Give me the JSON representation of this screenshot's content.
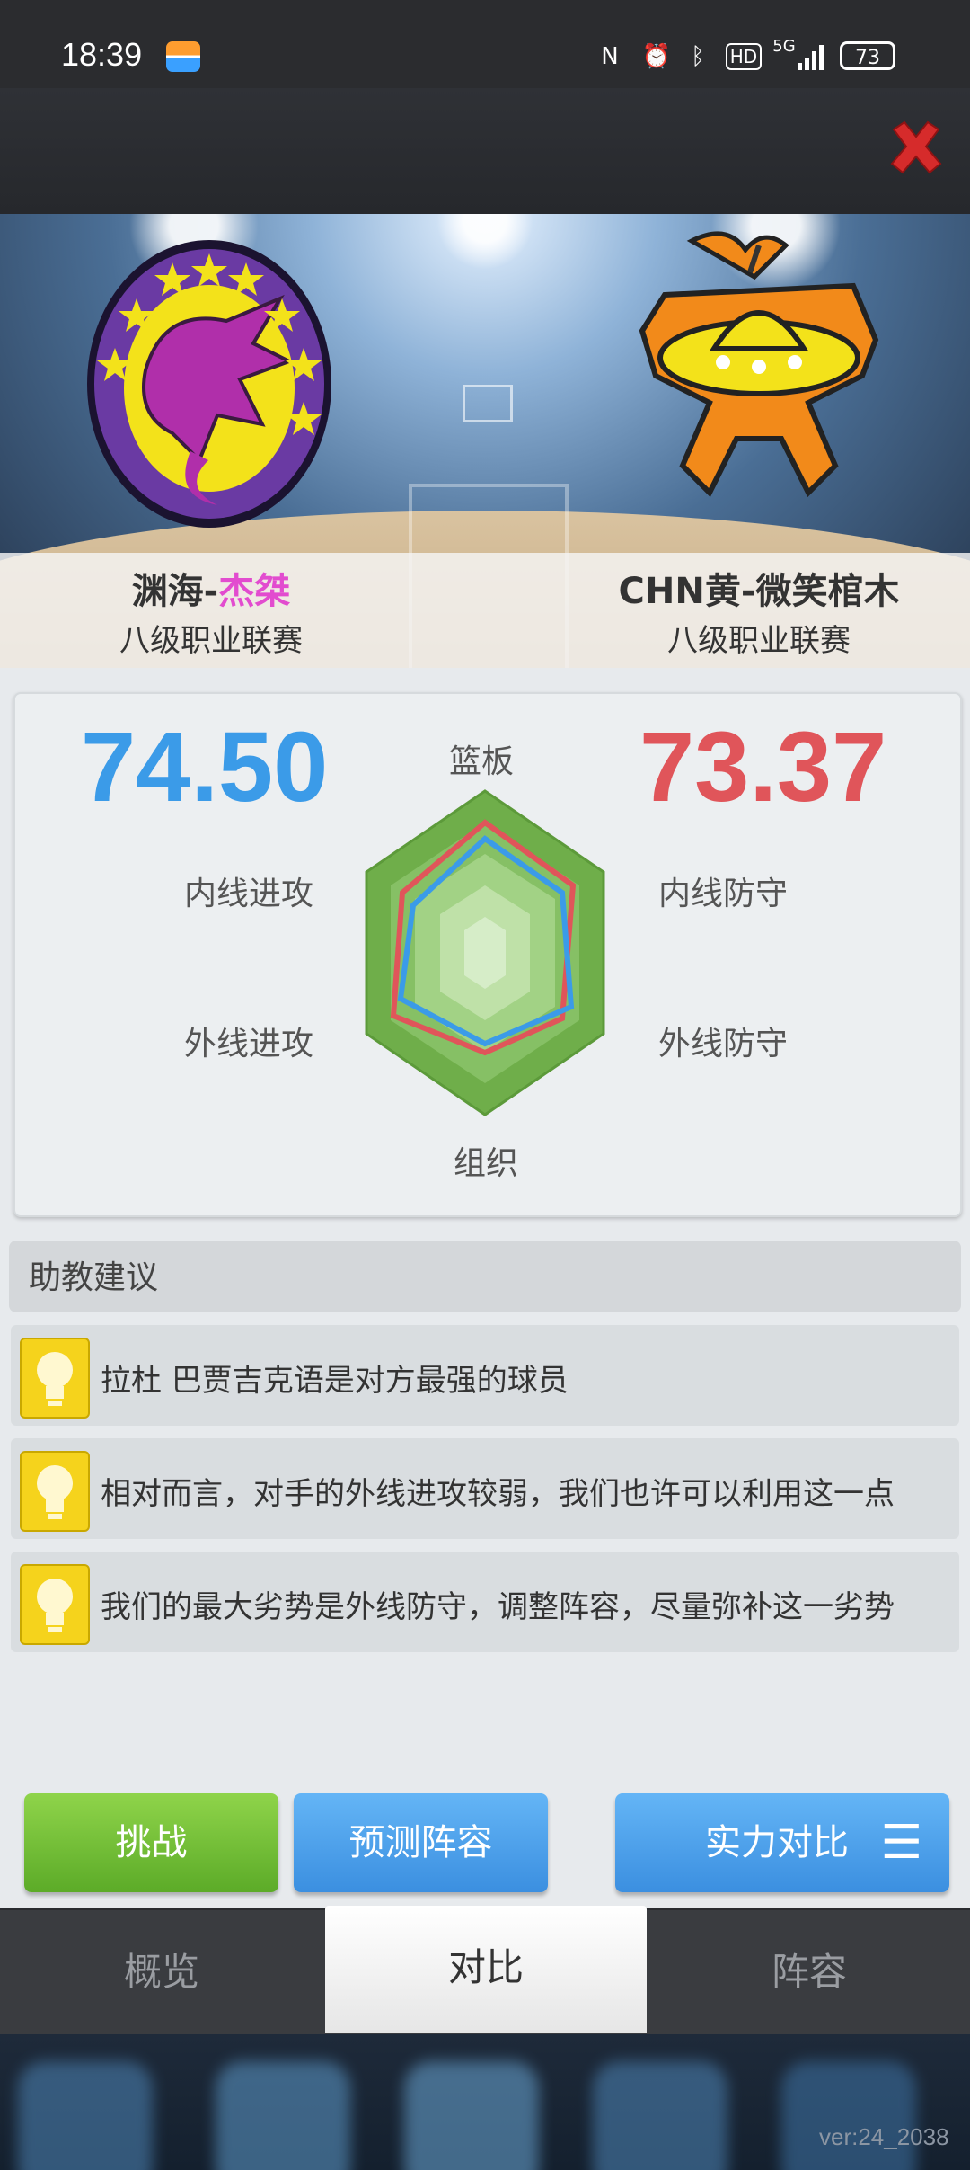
{
  "status_bar": {
    "time": "18:39",
    "battery": "73",
    "network": "5G",
    "hd": "HD"
  },
  "banner": {
    "home_team": {
      "name_prefix": "渊海-",
      "name_highlight": "杰桀",
      "league": "八级职业联赛"
    },
    "away_team": {
      "name": "CHN黄-微笑棺木",
      "league": "八级职业联赛"
    }
  },
  "compare": {
    "home_score": "74.50",
    "away_score": "73.37",
    "labels": {
      "top": "篮板",
      "left_upper": "内线进攻",
      "left_lower": "外线进攻",
      "right_upper": "内线防守",
      "right_lower": "外线防守",
      "bottom": "组织"
    },
    "colors": {
      "home": "#3b9be8",
      "away": "#e0555a"
    }
  },
  "advice": {
    "title": "助教建议",
    "items": [
      "拉杜 巴贾吉克语是对方最强的球员",
      "相对而言，对手的外线进攻较弱，我们也许可以利用这一点",
      "我们的最大劣势是外线防守，调整阵容，尽量弥补这一劣势"
    ]
  },
  "buttons": {
    "challenge": "挑战",
    "predict": "预测阵容",
    "strength": "实力对比"
  },
  "tabs": {
    "overview": "概览",
    "compare": "对比",
    "lineup": "阵容"
  },
  "footer": {
    "version": "ver:24_2038"
  }
}
